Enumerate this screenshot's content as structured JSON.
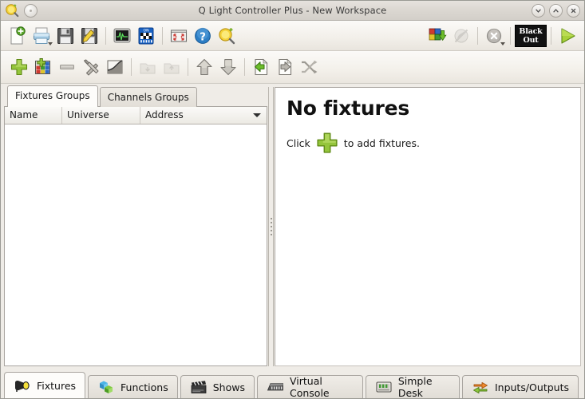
{
  "window": {
    "title": "Q Light Controller Plus - New Workspace",
    "logo_icon": "qlcplus-logo-icon",
    "menu_button_icon": "window-menu-icon",
    "buttons": [
      {
        "name": "minimize-button",
        "icon": "chevron-down-icon",
        "glyph": "⌄"
      },
      {
        "name": "maximize-button",
        "icon": "chevron-up-icon",
        "glyph": "⌃"
      },
      {
        "name": "close-button",
        "icon": "close-x-icon",
        "glyph": "✕"
      }
    ]
  },
  "toolbar_main": {
    "items": [
      {
        "name": "new-workspace-button",
        "icon": "new-document-icon",
        "label": "New"
      },
      {
        "name": "open-workspace-button",
        "icon": "open-folder-icon",
        "label": "Open"
      },
      {
        "name": "save-workspace-button",
        "icon": "save-floppy-icon",
        "label": "Save"
      },
      {
        "name": "save-as-workspace-button",
        "icon": "save-as-floppy-pencil-icon",
        "label": "Save As"
      },
      {
        "name": "dmx-monitor-button",
        "icon": "monitor-waveform-icon",
        "label": "Monitor"
      },
      {
        "name": "address-tool-button",
        "icon": "dip-switch-icon",
        "label": "DIP Switch"
      },
      {
        "name": "fullscreen-button",
        "icon": "fullscreen-icon",
        "label": "Toggle Full Screen"
      },
      {
        "name": "help-button",
        "icon": "help-question-icon",
        "label": "Help"
      },
      {
        "name": "about-button",
        "icon": "qlcplus-logo-icon",
        "label": "About"
      }
    ],
    "right_items": [
      {
        "name": "dump-dmx-button",
        "icon": "dump-dmx-blocks-icon",
        "label": "Dump DMX values"
      },
      {
        "name": "fade-disabled-button",
        "icon": "no-fade-icon",
        "label": "Disabled"
      },
      {
        "name": "stop-all-button",
        "icon": "stop-circle-icon",
        "label": "Stop all functions"
      },
      {
        "name": "blackout-button",
        "icon": "blackout-icon",
        "label_line1": "Black",
        "label_line2": "Out"
      },
      {
        "name": "operate-mode-button",
        "icon": "play-triangle-icon",
        "label": "Operate"
      }
    ]
  },
  "toolbar_fixtures": {
    "items": [
      {
        "name": "add-fixture-button",
        "icon": "plus-green-icon",
        "enabled": true
      },
      {
        "name": "add-rgb-panel-button",
        "icon": "rgb-panel-icon",
        "enabled": true
      },
      {
        "name": "remove-fixture-button",
        "icon": "minus-grey-icon",
        "enabled": false
      },
      {
        "name": "fixture-properties-button",
        "icon": "wrench-screwdriver-icon",
        "enabled": true
      },
      {
        "name": "fixture-fade-button",
        "icon": "fade-curve-icon",
        "enabled": true
      },
      {
        "name": "add-fixture-group-button",
        "icon": "group-in-icon",
        "enabled": false
      },
      {
        "name": "remove-fixture-group-button",
        "icon": "group-out-icon",
        "enabled": false
      },
      {
        "name": "move-up-button",
        "icon": "arrow-up-icon",
        "enabled": true
      },
      {
        "name": "move-down-button",
        "icon": "arrow-down-icon",
        "enabled": true
      },
      {
        "name": "import-fixtures-button",
        "icon": "import-document-icon",
        "enabled": true
      },
      {
        "name": "export-fixtures-button",
        "icon": "export-document-icon",
        "enabled": true
      },
      {
        "name": "remap-fixtures-button",
        "icon": "shuffle-arrows-icon",
        "enabled": true
      }
    ]
  },
  "group_tabs": [
    {
      "name": "tab-fixtures-groups",
      "label": "Fixtures Groups",
      "active": true
    },
    {
      "name": "tab-channels-groups",
      "label": "Channels Groups",
      "active": false
    }
  ],
  "fixture_list": {
    "columns": [
      {
        "name": "column-name",
        "label": "Name"
      },
      {
        "name": "column-universe",
        "label": "Universe"
      },
      {
        "name": "column-address",
        "label": "Address"
      }
    ],
    "rows": [],
    "header_menu_icon": "triangle-down-icon"
  },
  "detail_panel": {
    "title": "No fixtures",
    "hint_before": "Click",
    "hint_icon": "plus-green-icon",
    "hint_after": "to add fixtures."
  },
  "bottom_tabs": [
    {
      "name": "tab-fixtures",
      "label": "Fixtures",
      "icon": "spotlight-icon",
      "active": true
    },
    {
      "name": "tab-functions",
      "label": "Functions",
      "icon": "cubes-icon",
      "active": false
    },
    {
      "name": "tab-shows",
      "label": "Shows",
      "icon": "clapperboard-icon",
      "active": false
    },
    {
      "name": "tab-virtual-console",
      "label": "Virtual Console",
      "icon": "mixer-desk-icon",
      "active": false
    },
    {
      "name": "tab-simple-desk",
      "label": "Simple Desk",
      "icon": "faders-icon",
      "active": false
    },
    {
      "name": "tab-inputs-outputs",
      "label": "Inputs/Outputs",
      "icon": "inout-arrows-icon",
      "active": false
    }
  ],
  "colors": {
    "accent_green": "#8cbf26",
    "window_bg": "#efece7",
    "panel_white": "#ffffff",
    "titlebar": "#dcd8d2",
    "border": "#a9a5a0"
  }
}
